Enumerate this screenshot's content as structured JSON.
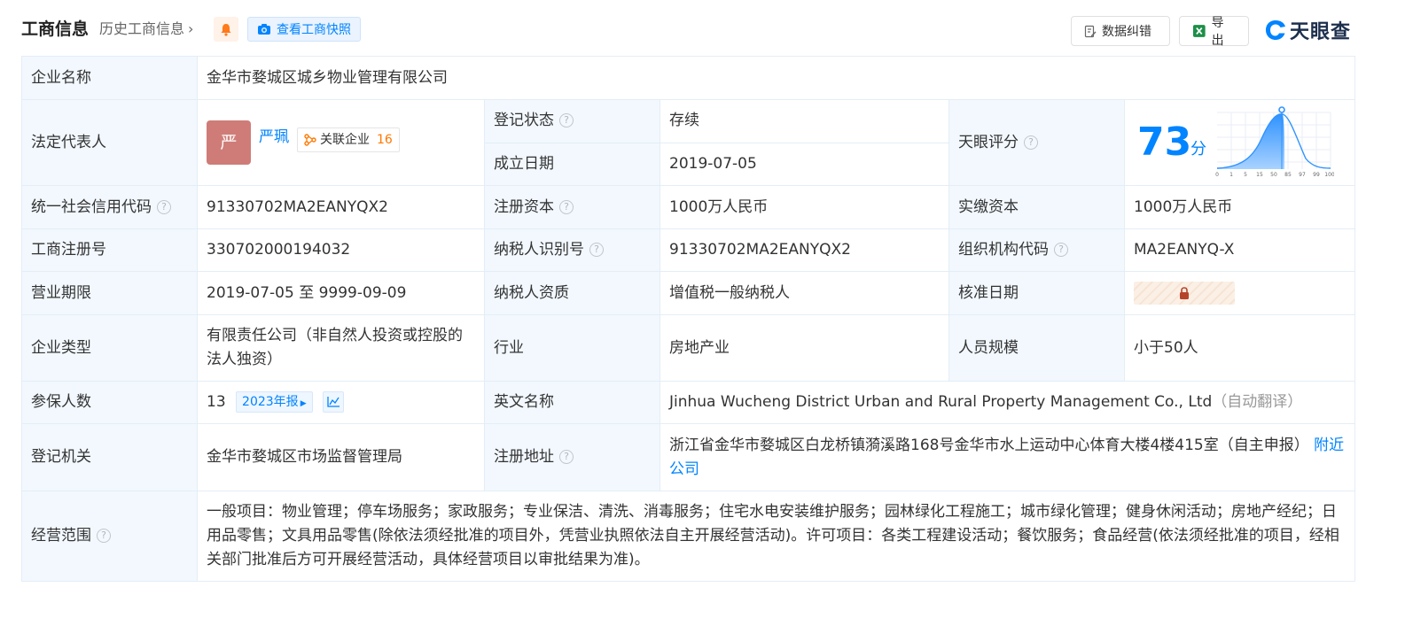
{
  "header": {
    "title": "工商信息",
    "history_link": "历史工商信息",
    "snapshot_btn": "查看工商快照",
    "correct_btn": "数据纠错",
    "export_btn": "导出",
    "logo_text": "天眼查",
    "accent": "#0084ff"
  },
  "rows": {
    "company_name_label": "企业名称",
    "company_name": "金华市婺城区城乡物业管理有限公司",
    "legal_rep_label": "法定代表人",
    "legal_rep_avatar": "严",
    "legal_rep_name": "严珮",
    "related_label": "关联企业",
    "related_count": "16",
    "reg_status_label": "登记状态",
    "reg_status": "存续",
    "found_date_label": "成立日期",
    "found_date": "2019-07-05",
    "score_label": "天眼评分",
    "score": "73",
    "score_unit": "分",
    "score_ticks": [
      "0",
      "1",
      "5",
      "15",
      "50",
      "85",
      "97",
      "99",
      "100"
    ],
    "credit_code_label": "统一社会信用代码",
    "credit_code": "91330702MA2EANYQX2",
    "reg_capital_label": "注册资本",
    "reg_capital": "1000万人民币",
    "paid_capital_label": "实缴资本",
    "paid_capital": "1000万人民币",
    "reg_no_label": "工商注册号",
    "reg_no": "330702000194032",
    "taxpayer_id_label": "纳税人识别号",
    "taxpayer_id": "91330702MA2EANYQX2",
    "org_code_label": "组织机构代码",
    "org_code": "MA2EANYQ-X",
    "term_label": "营业期限",
    "term": "2019-07-05 至 9999-09-09",
    "taxpayer_qual_label": "纳税人资质",
    "taxpayer_qual": "增值税一般纳税人",
    "approve_date_label": "核准日期",
    "company_type_label": "企业类型",
    "company_type": "有限责任公司（非自然人投资或控股的法人独资）",
    "industry_label": "行业",
    "industry": "房地产业",
    "staff_size_label": "人员规模",
    "staff_size": "小于50人",
    "insured_label": "参保人数",
    "insured": "13",
    "report_badge": "2023年报",
    "english_name_label": "英文名称",
    "english_name": "Jinhua Wucheng District Urban and Rural Property Management Co., Ltd",
    "auto_translate": "（自动翻译）",
    "authority_label": "登记机关",
    "authority": "金华市婺城区市场监督管理局",
    "address_label": "注册地址",
    "address": "浙江省金华市婺城区白龙桥镇漪溪路168号金华市水上运动中心体育大楼4楼415室（自主申报）",
    "nearby_link": "附近公司",
    "scope_label": "经营范围",
    "scope": "一般项目：物业管理；停车场服务；家政服务；专业保洁、清洗、消毒服务；住宅水电安装维护服务；园林绿化工程施工；城市绿化管理；健身休闲活动；房地产经纪；日用品零售；文具用品零售(除依法须经批准的项目外，凭营业执照依法自主开展经营活动)。许可项目：各类工程建设活动；餐饮服务；食品经营(依法须经批准的项目，经相关部门批准后方可开展经营活动，具体经营项目以审批结果为准)。"
  }
}
